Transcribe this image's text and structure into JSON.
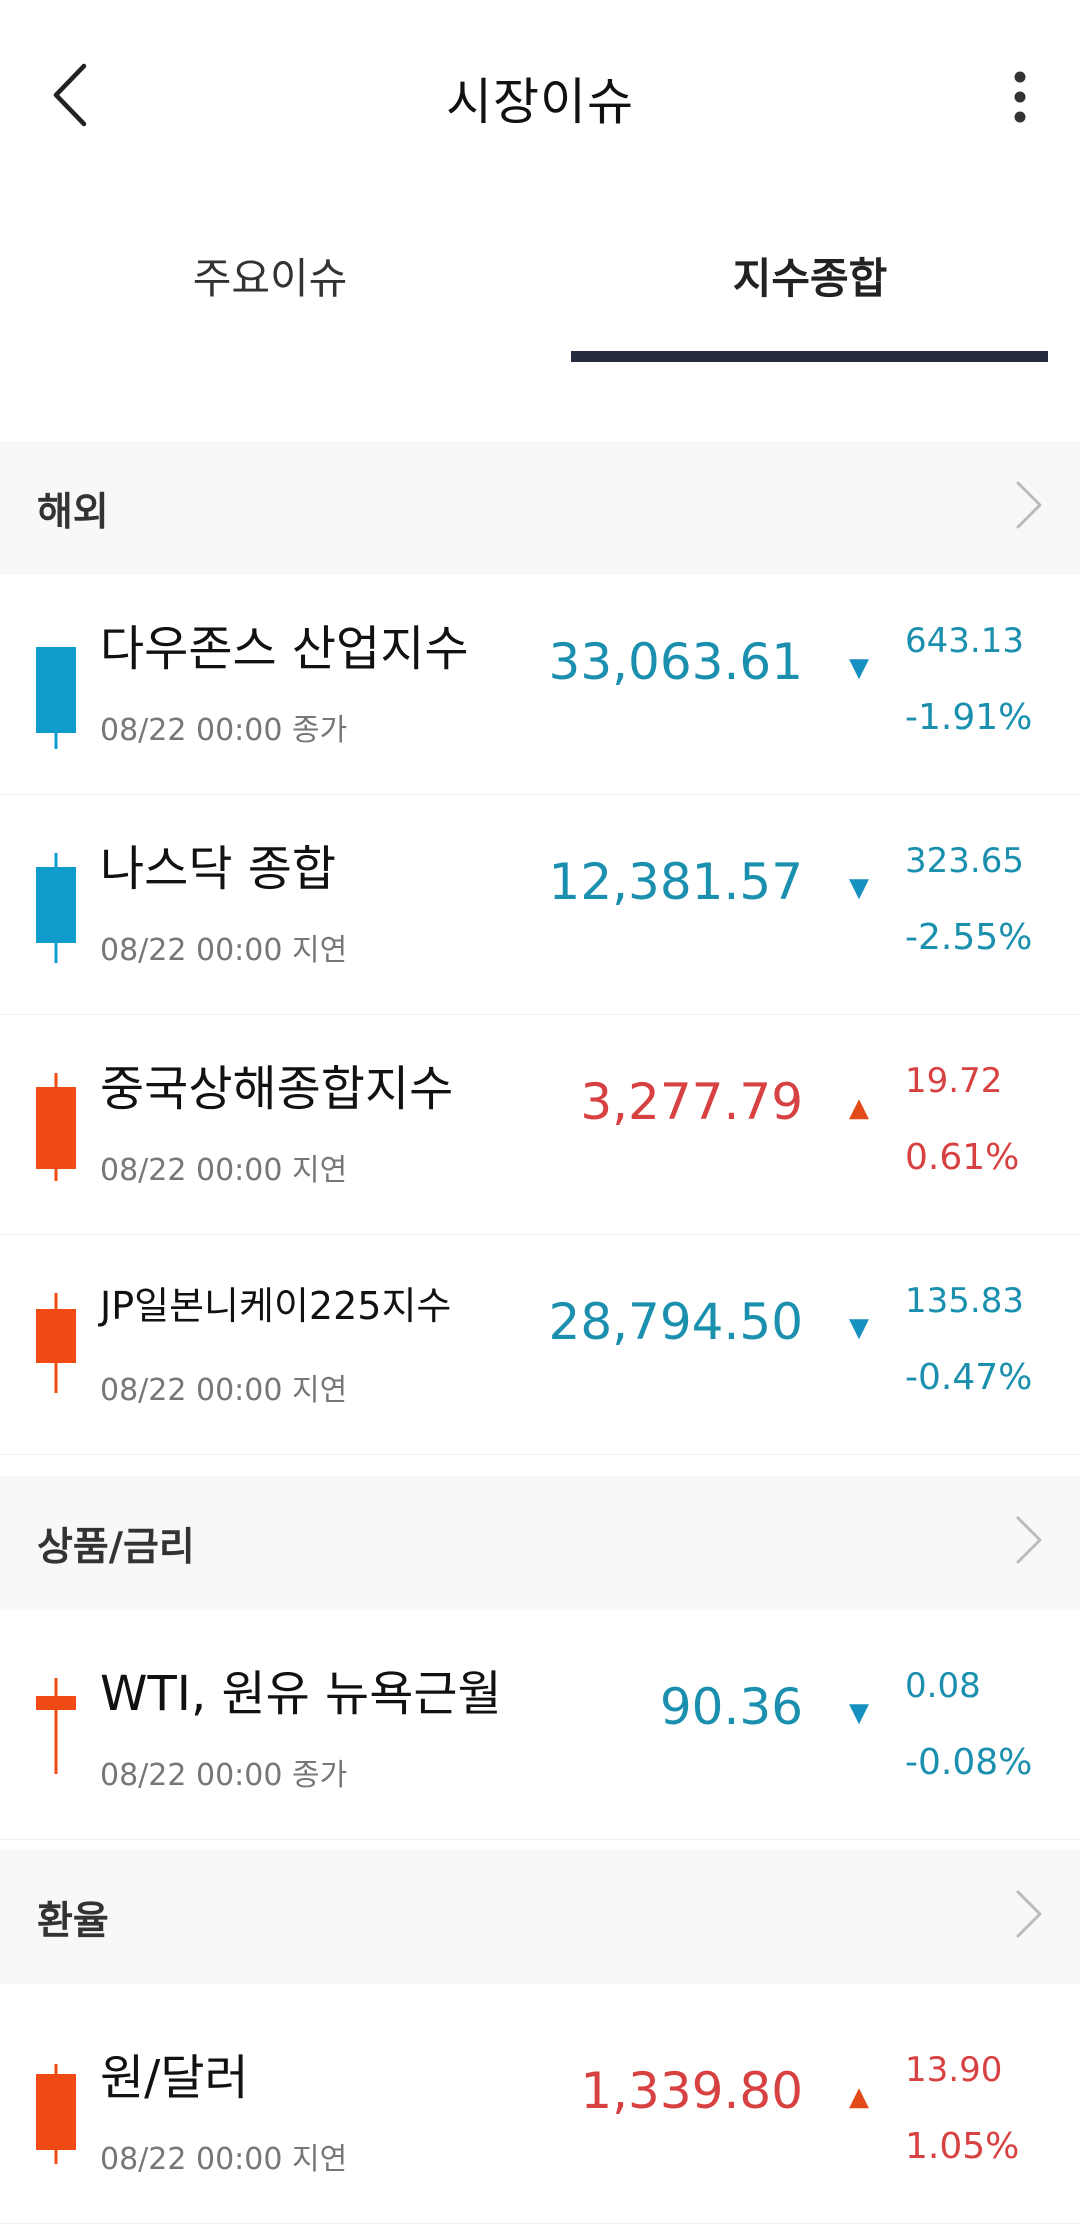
{
  "header": {
    "title": "시장이슈"
  },
  "tabs": [
    {
      "label": "주요이슈",
      "active": false
    },
    {
      "label": "지수종합",
      "active": true
    }
  ],
  "colors": {
    "down": "#1a8fae",
    "up": "#d84141",
    "candle_down": "#0d9ccc",
    "candle_up": "#f24a14",
    "tab_indicator": "#272b3f"
  },
  "sections": [
    {
      "title": "해외",
      "rows": [
        {
          "name": "다우존스 산업지수",
          "time": "08/22 00:00 종가",
          "price": "33,063.61",
          "direction": "down",
          "arrow": "▼",
          "change": "643.13",
          "pct": "-1.91%"
        },
        {
          "name": "나스닥 종합",
          "time": "08/22 00:00 지연",
          "price": "12,381.57",
          "direction": "down",
          "arrow": "▼",
          "change": "323.65",
          "pct": "-2.55%"
        },
        {
          "name": "중국상해종합지수",
          "time": "08/22 00:00 지연",
          "price": "3,277.79",
          "direction": "up",
          "arrow": "▲",
          "change": "19.72",
          "pct": "0.61%"
        },
        {
          "name": "JP일본니케이225지수",
          "time": "08/22 00:00 지연",
          "price": "28,794.50",
          "direction": "down",
          "arrow": "▼",
          "change": "135.83",
          "pct": "-0.47%"
        }
      ]
    },
    {
      "title": "상품/금리",
      "rows": [
        {
          "name": "WTI, 원유 뉴욕근월",
          "time": "08/22 00:00 종가",
          "price": "90.36",
          "direction": "down",
          "arrow": "▼",
          "change": "0.08",
          "pct": "-0.08%"
        }
      ]
    },
    {
      "title": "환율",
      "rows": [
        {
          "name": "원/달러",
          "time": "08/22 00:00 지연",
          "price": "1,339.80",
          "direction": "up",
          "arrow": "▲",
          "change": "13.90",
          "pct": "1.05%"
        }
      ]
    }
  ]
}
